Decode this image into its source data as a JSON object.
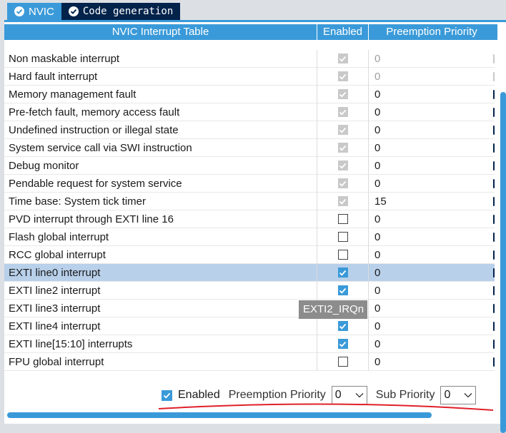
{
  "tabs": [
    {
      "label": "NVIC",
      "icon": "check-circle-icon"
    },
    {
      "label": "Code generation",
      "icon": "check-circle-icon"
    }
  ],
  "table": {
    "headers": {
      "name": "NVIC Interrupt Table",
      "enabled": "Enabled",
      "preemption": "Preemption Priority"
    },
    "rows": [
      {
        "name": "Non maskable interrupt",
        "enabled": true,
        "locked": true,
        "priority": "0",
        "priority_greyed": true
      },
      {
        "name": "Hard fault interrupt",
        "enabled": true,
        "locked": true,
        "priority": "0",
        "priority_greyed": true
      },
      {
        "name": "Memory management fault",
        "enabled": true,
        "locked": true,
        "priority": "0",
        "priority_greyed": false
      },
      {
        "name": "Pre-fetch fault, memory access fault",
        "enabled": true,
        "locked": true,
        "priority": "0",
        "priority_greyed": false
      },
      {
        "name": "Undefined instruction or illegal state",
        "enabled": true,
        "locked": true,
        "priority": "0",
        "priority_greyed": false
      },
      {
        "name": "System service call via SWI instruction",
        "enabled": true,
        "locked": true,
        "priority": "0",
        "priority_greyed": false
      },
      {
        "name": "Debug monitor",
        "enabled": true,
        "locked": true,
        "priority": "0",
        "priority_greyed": false
      },
      {
        "name": "Pendable request for system service",
        "enabled": true,
        "locked": true,
        "priority": "0",
        "priority_greyed": false
      },
      {
        "name": "Time base: System tick timer",
        "enabled": true,
        "locked": true,
        "priority": "15",
        "priority_greyed": false
      },
      {
        "name": "PVD interrupt through EXTI line 16",
        "enabled": false,
        "locked": false,
        "priority": "0",
        "priority_greyed": false
      },
      {
        "name": "Flash global interrupt",
        "enabled": false,
        "locked": false,
        "priority": "0",
        "priority_greyed": false
      },
      {
        "name": "RCC global interrupt",
        "enabled": false,
        "locked": false,
        "priority": "0",
        "priority_greyed": false
      },
      {
        "name": "EXTI line0 interrupt",
        "enabled": true,
        "locked": false,
        "priority": "0",
        "priority_greyed": false,
        "selected": true
      },
      {
        "name": "EXTI line2 interrupt",
        "enabled": true,
        "locked": false,
        "priority": "0",
        "priority_greyed": false
      },
      {
        "name": "EXTI line3 interrupt",
        "enabled": true,
        "locked": false,
        "priority": "0",
        "priority_greyed": false
      },
      {
        "name": "EXTI line4 interrupt",
        "enabled": true,
        "locked": false,
        "priority": "0",
        "priority_greyed": false
      },
      {
        "name": "EXTI line[15:10] interrupts",
        "enabled": true,
        "locked": false,
        "priority": "0",
        "priority_greyed": false
      },
      {
        "name": "FPU global interrupt",
        "enabled": false,
        "locked": false,
        "priority": "0",
        "priority_greyed": false
      }
    ]
  },
  "tooltip": {
    "text": "EXTI2_IRQn"
  },
  "bottom_bar": {
    "enabled_label": "Enabled",
    "enabled_checked": true,
    "preemption_label": "Preemption Priority",
    "preemption_value": "0",
    "sub_label": "Sub Priority",
    "sub_value": "0"
  },
  "colors": {
    "accent": "#3a9ad9",
    "dark_tab": "#03234b",
    "selected_row": "#b8d0ea",
    "annotation": "#e0202a"
  }
}
